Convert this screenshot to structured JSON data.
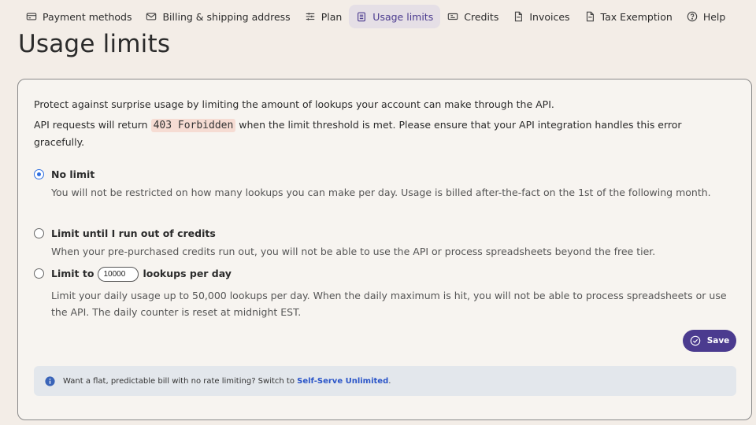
{
  "nav": {
    "tabs": [
      {
        "label": "Payment methods",
        "icon": "credit-card-icon"
      },
      {
        "label": "Billing & shipping address",
        "icon": "envelope-icon"
      },
      {
        "label": "Plan",
        "icon": "sliders-icon"
      },
      {
        "label": "Usage limits",
        "icon": "clipboard-icon",
        "active": true
      },
      {
        "label": "Credits",
        "icon": "ticket-icon"
      },
      {
        "label": "Invoices",
        "icon": "document-icon"
      },
      {
        "label": "Tax Exemption",
        "icon": "document-icon"
      },
      {
        "label": "Help",
        "icon": "question-icon"
      }
    ]
  },
  "page": {
    "title": "Usage limits"
  },
  "intro": {
    "line1": "Protect against surprise usage by limiting the amount of lookups your account can make through the API.",
    "line2_pre": "API requests will return ",
    "line2_code": "403 Forbidden",
    "line2_post": " when the limit threshold is met. Please ensure that your API integration handles this error gracefully."
  },
  "options": {
    "no_limit": {
      "label": "No limit",
      "desc": "You will not be restricted on how many lookups you can make per day. Usage is billed after-the-fact on the 1st of the following month."
    },
    "credits": {
      "label": "Limit until I run out of credits",
      "desc": "When your pre-purchased credits run out, you will not be able to use the API or process spreadsheets beyond the free tier."
    },
    "daily": {
      "label_pre": "Limit to",
      "value": "10000",
      "label_post": "lookups per day",
      "desc": "Limit your daily usage up to 50,000 lookups per day. When the daily maximum is hit, you will not be able to process spreadsheets or use the API. The daily counter is reset at midnight EST."
    },
    "selected": "no_limit"
  },
  "save": {
    "label": "Save"
  },
  "info": {
    "text": "Want a flat, predictable bill with no rate limiting? Switch to ",
    "link": "Self-Serve Unlimited",
    "suffix": "."
  },
  "colors": {
    "accent": "#4b3b8f",
    "radio": "#2f6fe0",
    "link": "#2b55c8",
    "code_bg": "#f6dcd3"
  }
}
